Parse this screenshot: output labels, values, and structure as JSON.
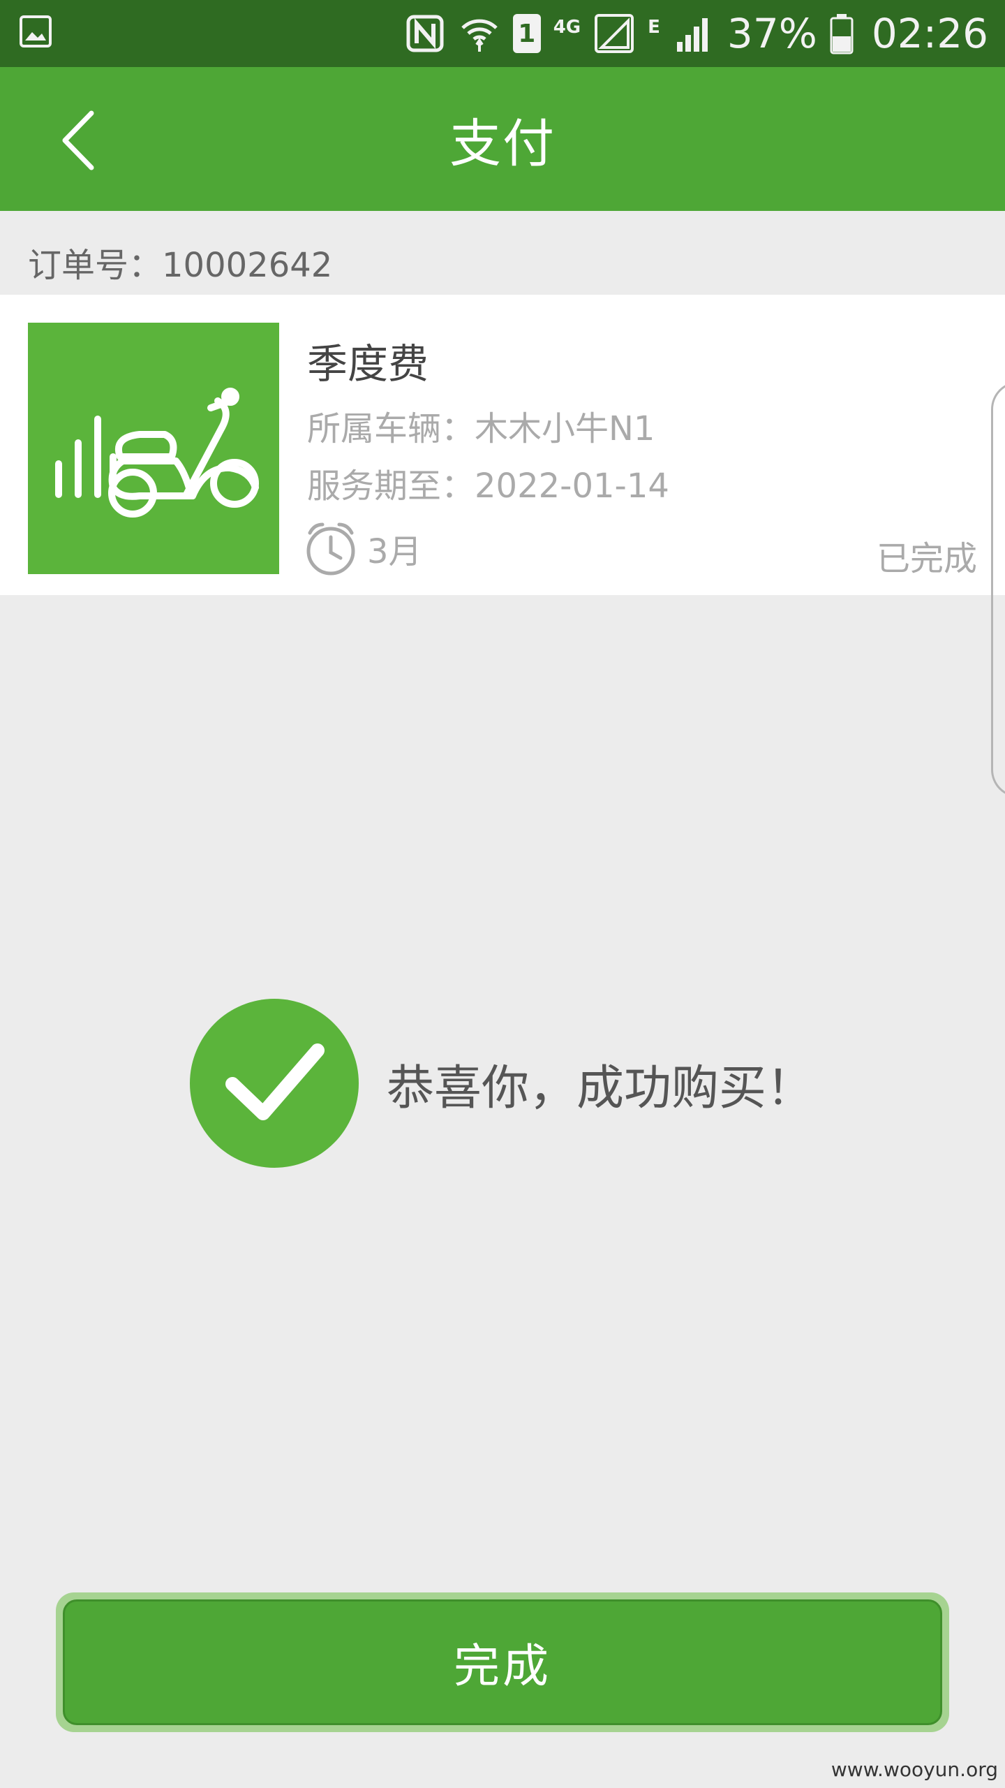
{
  "status_bar": {
    "network_label": "4G",
    "signal_label": "E",
    "sim_slot": "1",
    "battery_percent": "37%",
    "time": "02:26",
    "icons": [
      "gallery-icon",
      "nfc-icon",
      "wifi-icon",
      "sim-icon",
      "signal-icon",
      "battery-icon"
    ]
  },
  "header": {
    "title": "支付",
    "back_icon": "chevron-left-icon"
  },
  "order": {
    "number_label": "订单号：10002642"
  },
  "card": {
    "thumbnail_icon": "scooter-icon",
    "product_name": "季度费",
    "vehicle_line": "所属车辆：木木小牛N1",
    "service_line": "服务期至：2022-01-14",
    "duration": "3月",
    "duration_icon": "alarm-clock-icon",
    "status": "已完成"
  },
  "success": {
    "icon": "checkmark-icon",
    "message": "恭喜你，成功购买！"
  },
  "footer": {
    "done_label": "完成"
  },
  "watermark": "www.wooyun.org",
  "colors": {
    "brand_green": "#4ea736",
    "status_bar": "#2f6b22",
    "accent_green": "#5bb43b",
    "background": "#ececec"
  }
}
